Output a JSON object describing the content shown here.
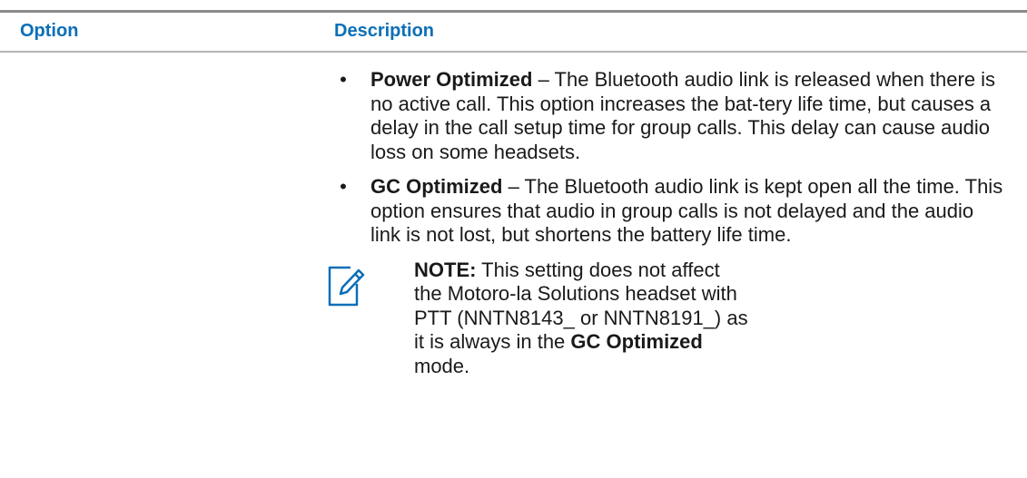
{
  "table": {
    "header": {
      "option": "Option",
      "description": "Description"
    },
    "row": {
      "bullets": [
        {
          "term": "Power Optimized",
          "text": " – The Bluetooth audio link is released when there is no active call. This option increases the bat-tery life time, but causes a delay in the call setup time for group calls. This delay can cause audio loss on some headsets."
        },
        {
          "term": "GC Optimized",
          "text": " – The Bluetooth audio link is kept open all the time. This option ensures that audio in group calls is not delayed and the audio link is not lost, but shortens the battery life time."
        }
      ],
      "note": {
        "icon": "note-pencil-icon",
        "label": "NOTE:",
        "text_before": " This setting does not affect the Motoro-la Solutions headset with PTT (NNTN8143_ or NNTN8191_) as it is always in the ",
        "emphasis": "GC Optimized",
        "text_after": " mode."
      }
    }
  },
  "colors": {
    "header_text": "#0b6fb7",
    "rule": "#8a8a8a",
    "body_text": "#1a1a1a"
  }
}
